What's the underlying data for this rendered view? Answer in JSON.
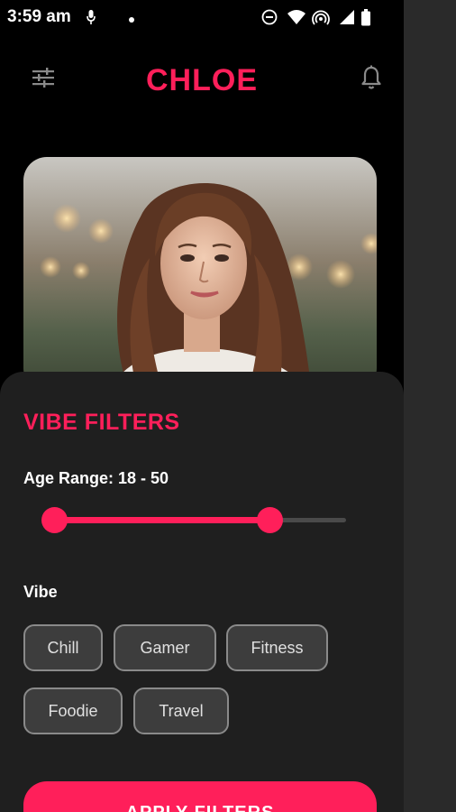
{
  "status_bar": {
    "time": "3:59 am"
  },
  "app_bar": {
    "title": "CHLOE"
  },
  "filters": {
    "title": "VIBE FILTERS",
    "age_range_label": "Age Range: 18 - 50",
    "age_slider": {
      "low_fraction": 0.0,
      "high_fraction": 0.74
    },
    "vibe_label": "Vibe",
    "vibes": [
      "Chill",
      "Gamer",
      "Fitness",
      "Foodie",
      "Travel"
    ],
    "apply_label": "APPLY FILTERS"
  },
  "colors": {
    "accent": "#ff1f5a",
    "background": "#000000",
    "sheet": "#1f1f1f",
    "chip": "#3d3d3d"
  }
}
